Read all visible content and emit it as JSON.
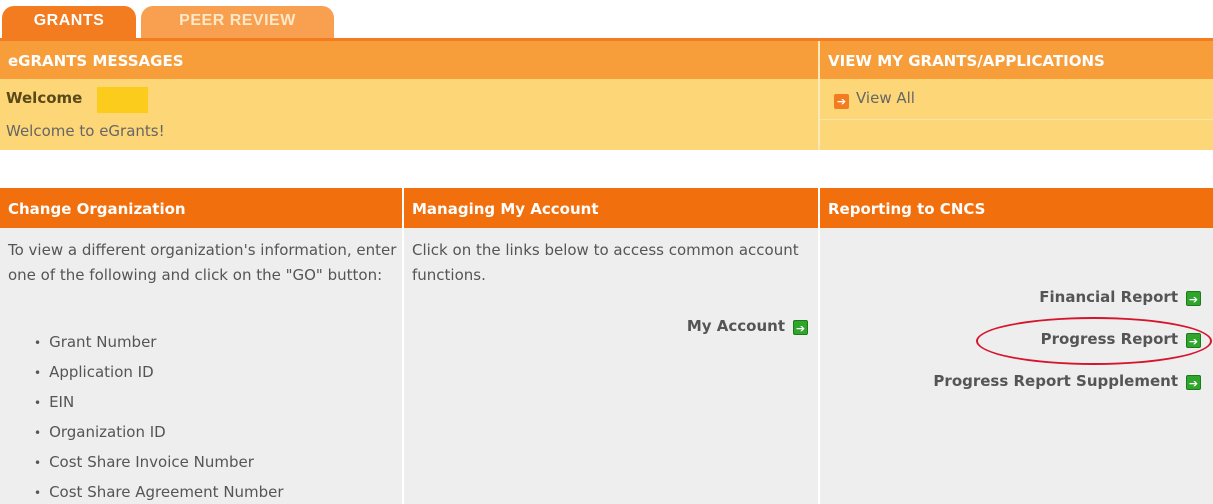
{
  "tabs": [
    {
      "label": "GRANTS"
    },
    {
      "label": "PEER REVIEW"
    }
  ],
  "messages": {
    "header": "eGRANTS MESSAGES",
    "welcome_label": "Welcome",
    "welcome_text": "Welcome to eGrants!"
  },
  "grants": {
    "header": "VIEW MY GRANTS/APPLICATIONS",
    "view_all": "View All"
  },
  "change_org": {
    "header": "Change Organization",
    "description": "To view a different organization's information, enter one of the following and click on the \"GO\" button:",
    "items": [
      "Grant Number",
      "Application ID",
      "EIN",
      "Organization ID",
      "Cost Share Invoice Number",
      "Cost Share Agreement Number"
    ]
  },
  "account": {
    "header": "Managing My Account",
    "description": "Click on the links below to access common account functions.",
    "my_account": "My Account"
  },
  "reporting": {
    "header": "Reporting to CNCS",
    "links": [
      "Financial Report",
      "Progress Report",
      "Progress Report Supplement"
    ]
  },
  "colors": {
    "accent_orange": "#f47c20",
    "header_orange": "#f26f0d",
    "panel_yellow": "#fdd677",
    "link_arrow_green": "#2fa52b",
    "annotation_red": "#d6142c"
  }
}
